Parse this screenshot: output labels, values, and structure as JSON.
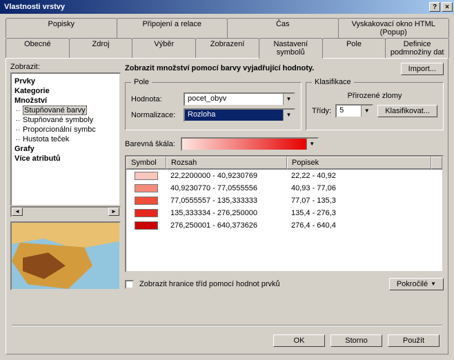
{
  "window": {
    "title": "Vlastnosti vrstvy",
    "help": "?",
    "close": "×"
  },
  "tabs_row1": [
    "Popisky",
    "Připojení a relace",
    "Čas",
    "Vyskakovací okno HTML (Popup)"
  ],
  "tabs_row2": [
    "Obecné",
    "Zdroj",
    "Výběr",
    "Zobrazení",
    "Nastavení symbolů",
    "Pole",
    "Definice podmnožiny dat"
  ],
  "active_tab": "Nastavení symbolů",
  "left": {
    "label": "Zobrazit:",
    "tree": {
      "prvky": "Prvky",
      "kategorie": "Kategorie",
      "mnozstvi": "Množství",
      "children": [
        "Stupňované barvy",
        "Stupňované symboly",
        "Proporcionální symbc",
        "Hustota teček"
      ],
      "selected_index": 0,
      "grafy": "Grafy",
      "vice": "Více atributů"
    }
  },
  "right": {
    "heading": "Zobrazit množství pomocí barvy vyjadřující hodnoty.",
    "import_btn": "Import...",
    "pole_legend": "Pole",
    "hodnota_label": "Hodnota:",
    "hodnota_value": "pocet_obyv",
    "normalizace_label": "Normalizace:",
    "normalizace_value": "Rozloha",
    "klas_legend": "Klasifikace",
    "klas_method": "Přirozené zlomy",
    "tridy_label": "Třídy:",
    "tridy_value": "5",
    "klasifikovat_btn": "Klasifikovat...",
    "ramp_label": "Barevná škála:",
    "grid": {
      "h_symbol": "Symbol",
      "h_rozsah": "Rozsah",
      "h_popisek": "Popisek",
      "rows": [
        {
          "color": "#f9c6bd",
          "rozsah": "22,2200000 - 40,9230769",
          "popisek": "22,22 - 40,92"
        },
        {
          "color": "#f48a78",
          "rozsah": "40,9230770 - 77,0555556",
          "popisek": "40,93 - 77,06"
        },
        {
          "color": "#ef4e3b",
          "rozsah": "77,0555557 - 135,333333",
          "popisek": "77,07 - 135,3"
        },
        {
          "color": "#e6271c",
          "rozsah": "135,333334 - 276,250000",
          "popisek": "135,4 - 276,3"
        },
        {
          "color": "#cc0000",
          "rozsah": "276,250001 - 640,373626",
          "popisek": "276,4 - 640,4"
        }
      ]
    },
    "show_bounds_label": "Zobrazit hranice tříd pomocí hodnot prvků",
    "advanced_btn": "Pokročilé"
  },
  "buttons": {
    "ok": "OK",
    "storno": "Storno",
    "pouzit": "Použít"
  }
}
